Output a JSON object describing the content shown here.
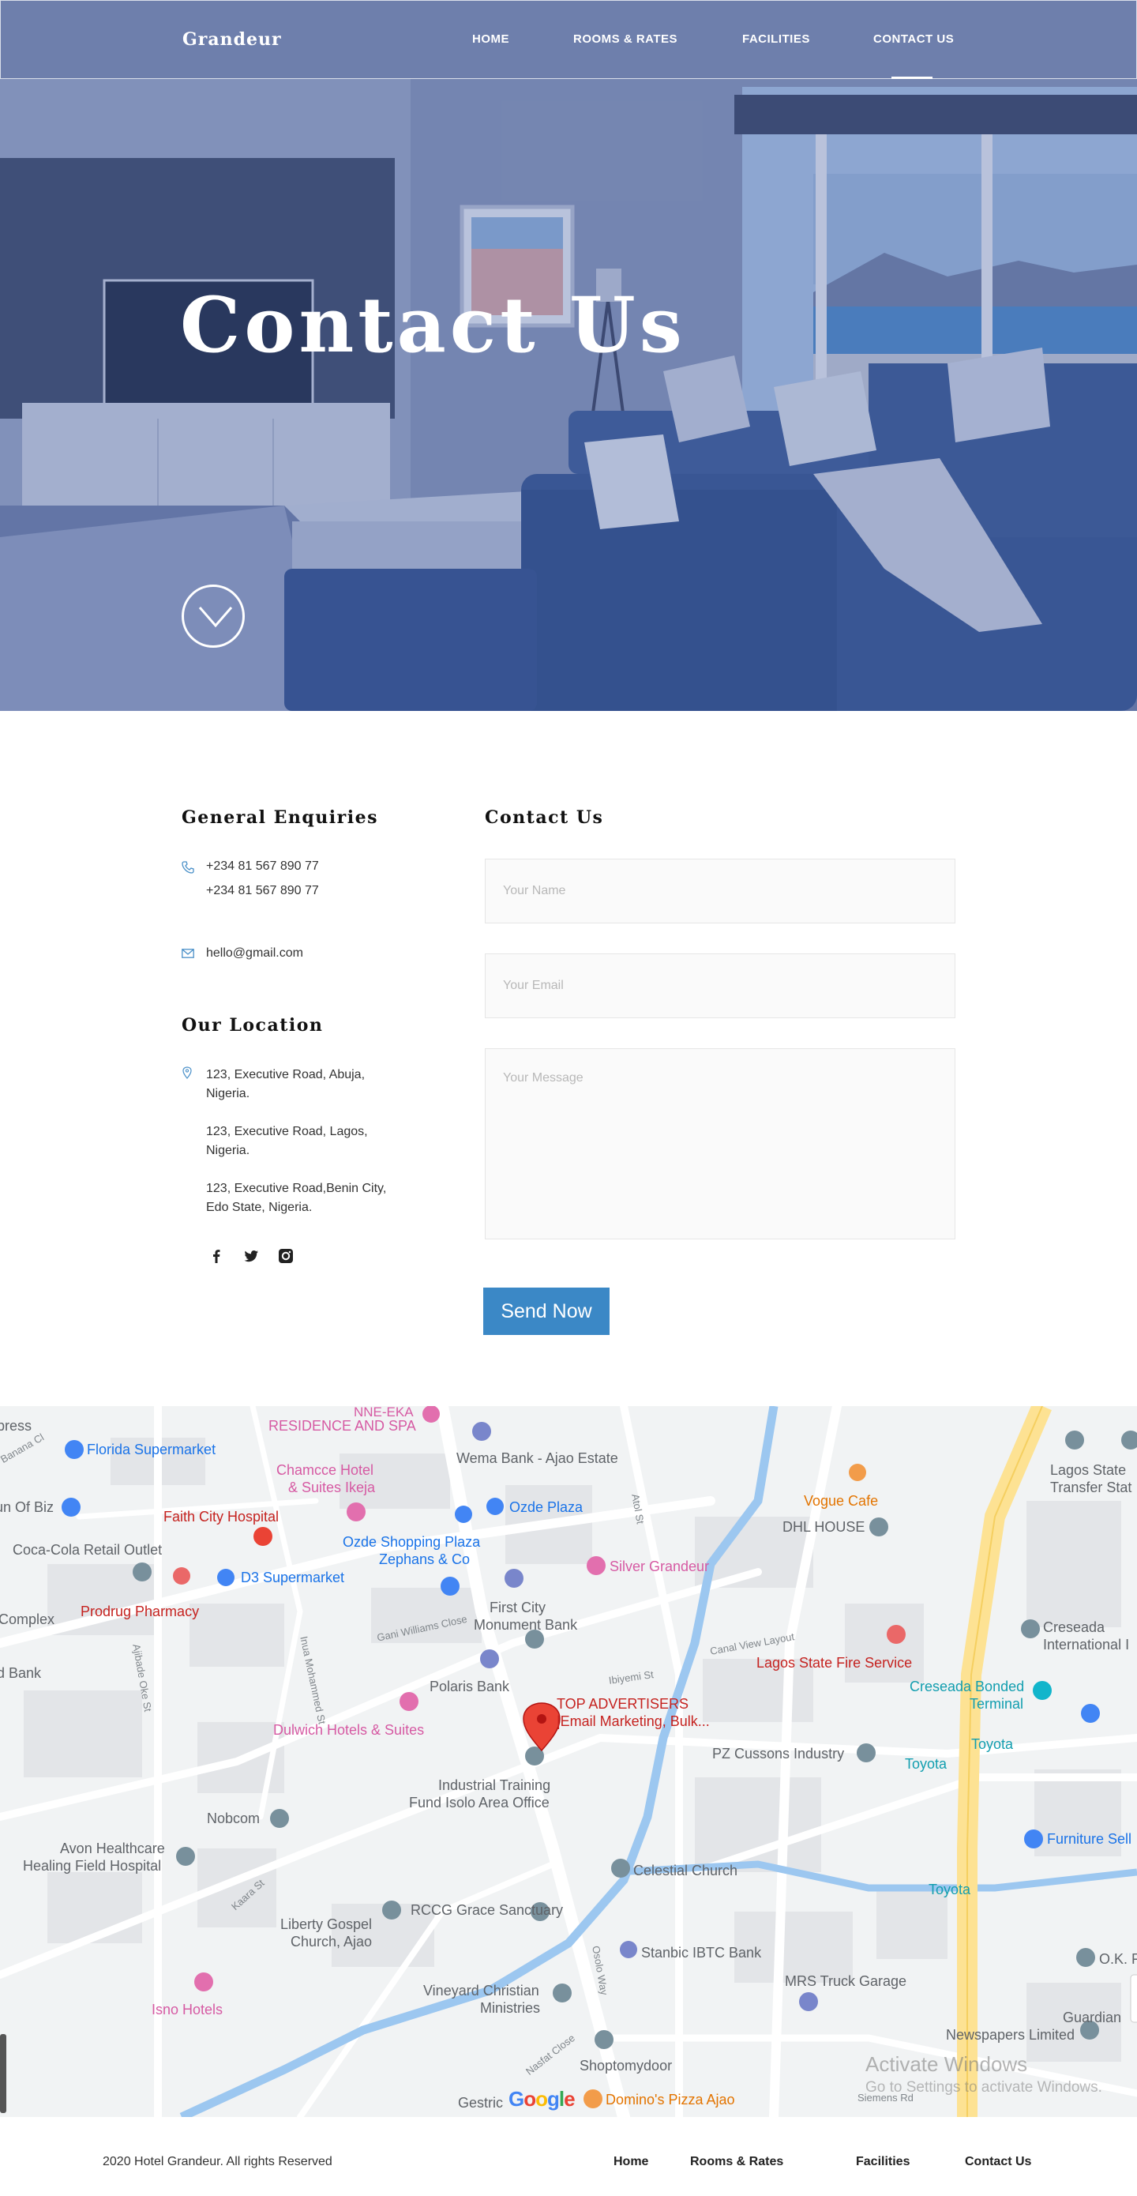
{
  "nav": {
    "brand": "Grandeur",
    "items": [
      {
        "label": "HOME"
      },
      {
        "label": "ROOMS & RATES"
      },
      {
        "label": "FACILITIES"
      },
      {
        "label": "CONTACT US"
      }
    ],
    "active": "CONTACT US"
  },
  "hero": {
    "title": "Contact Us"
  },
  "enquiries": {
    "heading": "General Enquiries",
    "phone1": "+234 81 567 890 77",
    "phone2": "+234 81 567 890 77",
    "email": "hello@gmail.com"
  },
  "location": {
    "heading": "Our Location",
    "addresses": [
      {
        "line1": "123, Executive Road, Abuja,",
        "line2": "Nigeria."
      },
      {
        "line1": "123, Executive Road, Lagos,",
        "line2": "Nigeria."
      },
      {
        "line1": "123, Executive Road,Benin City,",
        "line2": "Edo State, Nigeria."
      }
    ],
    "social_icons": [
      "facebook-icon",
      "twitter-icon",
      "instagram-icon"
    ]
  },
  "form": {
    "heading": "Contact Us",
    "name_placeholder": "Your Name",
    "email_placeholder": "Your Email",
    "message_placeholder": "Your Message",
    "submit_label": "Send Now"
  },
  "map": {
    "places": {
      "florida": "Florida Supermarket",
      "residence": "RESIDENCE AND SPA",
      "nne": "NNE-EKA",
      "wema": "Wema Bank - Ajao Estate",
      "chamcce1": "Chamcce Hotel",
      "chamcce2": "& Suites Ikeja",
      "ozde": "Ozde Plaza",
      "faith": "Faith City Hospital",
      "cocacola": "Coca-Cola Retail Outlet",
      "unofbiz": "un Of Biz",
      "ozdeshop1": "Ozde Shopping Plaza",
      "ozdeshop2": "Zephans & Co",
      "d3": "D3 Supermarket",
      "silver": "Silver Grandeur",
      "vogue": "Vogue Cafe",
      "dhl": "DHL HOUSE",
      "lagosstate1": "Lagos State",
      "lagosstate2": "Transfer Stat",
      "prodrug": "Prodrug Pharmacy",
      "complex": "Complex",
      "firstcity1": "First City",
      "firstcity2": "Monument Bank",
      "fire": "Lagos State Fire Service",
      "creseada1": "Creseada",
      "creseada2": "International I",
      "bank": "d Bank",
      "polaris": "Polaris Bank",
      "creseadabonded1": "Creseada Bonded",
      "creseadabonded2": "Terminal",
      "dulwich": "Dulwich Hotels & Suites",
      "topadv1": "TOP ADVERTISERS",
      "topadv2": "|Email Marketing, Bulk...",
      "pzc": "PZ Cussons Industry",
      "toyota1": "Toyota",
      "toyota2": "Toyota",
      "toyota3": "Toyota",
      "itf1": "Industrial Training",
      "itf2": "Fund Isolo Area Office",
      "nobcom": "Nobcom",
      "furniture": "Furniture Sell",
      "avon1": "Avon Healthcare",
      "avon2": "Healing Field Hospital",
      "celestial": "Celestial Church",
      "rccg": "RCCG Grace Sanctuary",
      "liberty1": "Liberty Gospel",
      "liberty2": "Church, Ajao",
      "stanbic": "Stanbic IBTC Bank",
      "ok": "O.K. F",
      "isno": "Isno Hotels",
      "vineyard1": "Vineyard Christian",
      "vineyard2": "Ministries",
      "mrs": "MRS Truck Garage",
      "guardian1": "Guardian",
      "guardian2": "Newspapers Limited",
      "shoptomy": "Shoptomydoor",
      "dominos": "Domino's Pizza Ajao",
      "gestric": "Gestric",
      "press": "press"
    },
    "streets": {
      "ajibade": "Ajibade Oke St",
      "inua": "Inua Mohammed St",
      "gani": "Gani Williams Close",
      "ibiyemi": "Ibiyemi St",
      "canal": "Canal View Layout",
      "kaara": "Kaara St",
      "osolo": "Osolo Way",
      "nasfat": "Nasfat Close",
      "siemens": "Siemens Rd",
      "atol": "Atol St",
      "banana": "Banana Cl"
    },
    "watermark_title": "Activate Windows",
    "watermark_sub": "Go to Settings to activate Windows.",
    "google": [
      "G",
      "o",
      "o",
      "g",
      "l",
      "e"
    ]
  },
  "footer": {
    "copyright": "2020 Hotel Grandeur. All rights Reserved",
    "links": [
      "Home",
      "Rooms & Rates",
      "Facilities",
      "Contact Us"
    ]
  }
}
